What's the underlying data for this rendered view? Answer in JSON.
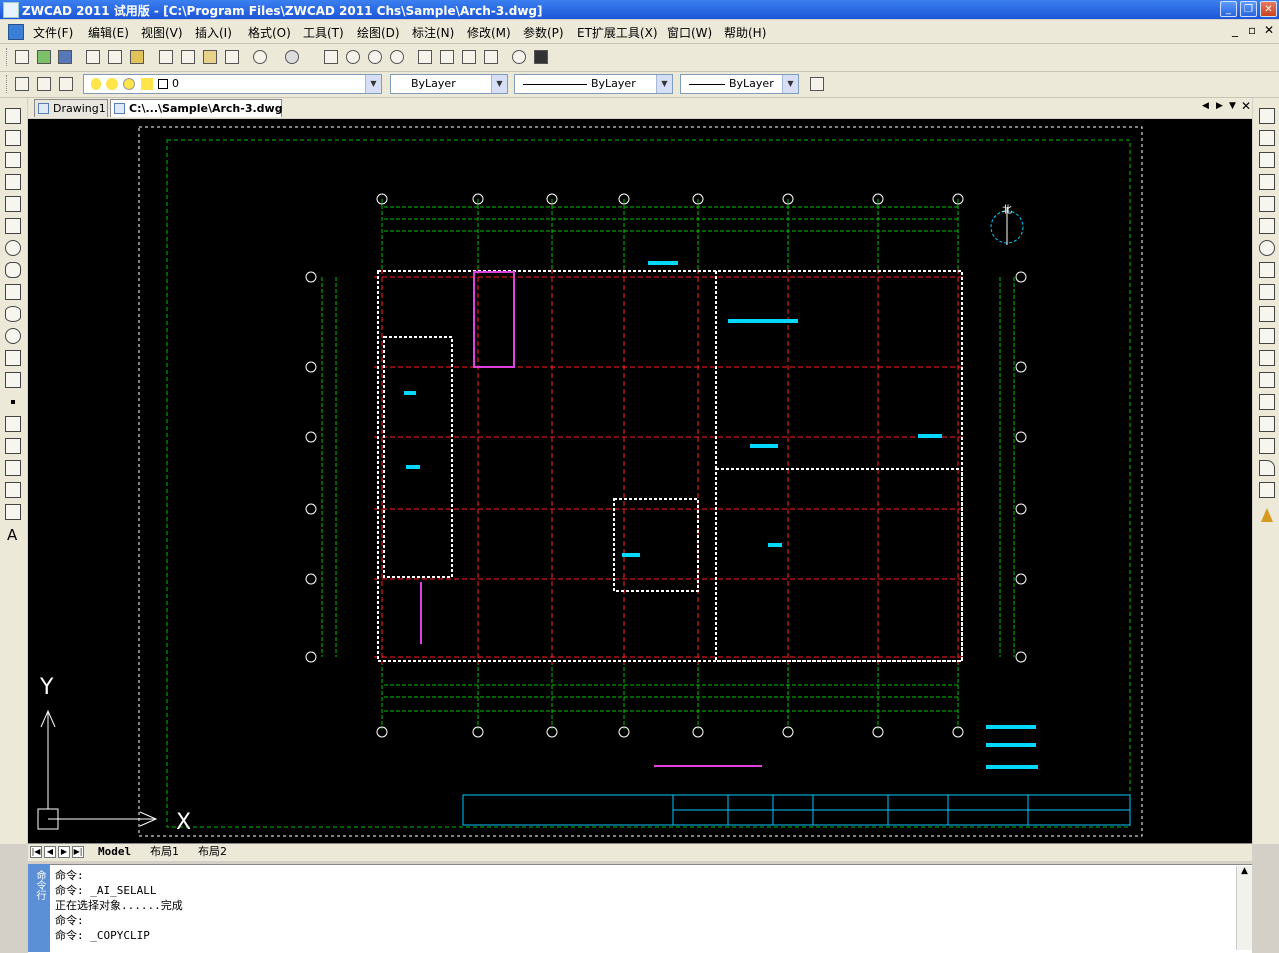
{
  "window": {
    "title": "ZWCAD 2011 试用版 - [C:\\Program Files\\ZWCAD 2011 Chs\\Sample\\Arch-3.dwg]",
    "controls": [
      "minimize",
      "restore",
      "close"
    ]
  },
  "menu": {
    "items": [
      "文件(F)",
      "编辑(E)",
      "视图(V)",
      "插入(I)",
      "格式(O)",
      "工具(T)",
      "绘图(D)",
      "标注(N)",
      "修改(M)",
      "参数(P)",
      "ET扩展工具(X)",
      "窗口(W)",
      "帮助(H)"
    ],
    "mdi_controls": [
      "_",
      "▫",
      "✕"
    ]
  },
  "layer_toolbar": {
    "layer_value": "0",
    "color_value": "ByLayer",
    "linetype_value": "ByLayer",
    "lineweight_value": "ByLayer"
  },
  "doc_tabs": [
    {
      "label": "Drawing1",
      "active": false
    },
    {
      "label": "C:\\...\\Sample\\Arch-3.dwg",
      "active": true
    }
  ],
  "drawing": {
    "background": "#000000",
    "line_colors": {
      "grid": "#00c000",
      "wall": "#ffffff",
      "axis": "#ff2020",
      "accent": "#e040e0",
      "text": "#00d8ff"
    },
    "north_label": "北",
    "ucs_y": "Y",
    "ucs_x": "X"
  },
  "layout_tabs": {
    "tabs": [
      "Model",
      "布局1",
      "布局2"
    ],
    "active": "Model"
  },
  "command": {
    "lines": [
      "命令:",
      "命令: _AI_SELALL",
      "正在选择对象......完成",
      "命令:",
      "命令: _COPYCLIP"
    ],
    "side_label": "命令行"
  }
}
